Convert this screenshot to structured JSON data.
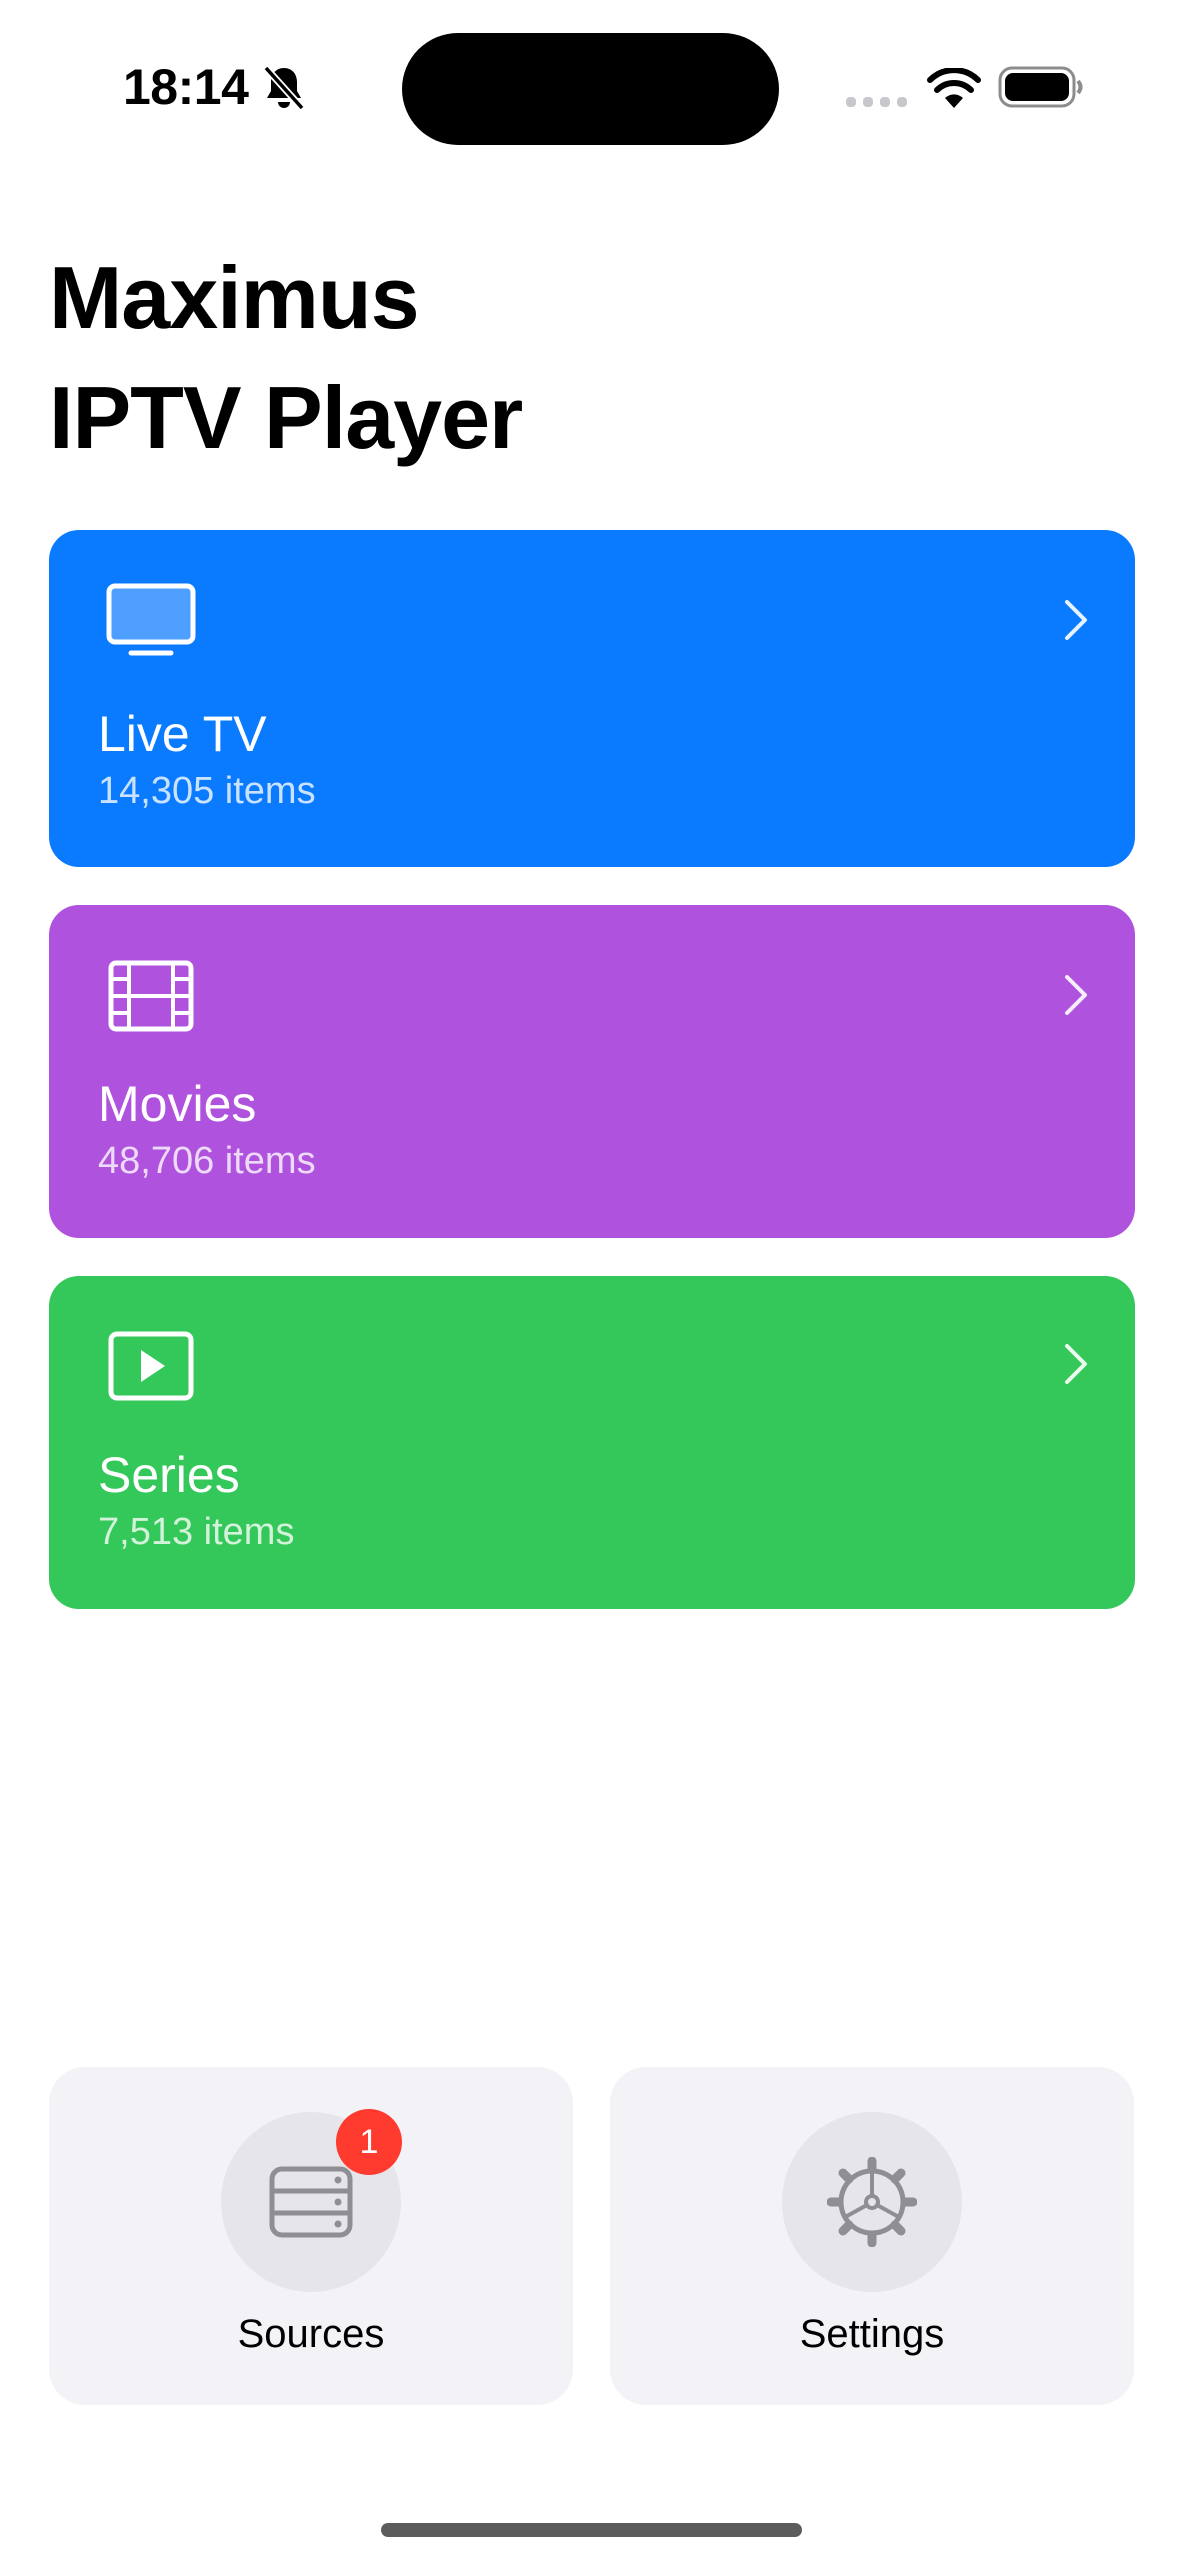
{
  "status_bar": {
    "time": "18:14",
    "icons": [
      "bell-slash-icon",
      "cellular-signal-icon",
      "wifi-icon",
      "battery-icon"
    ]
  },
  "title": "Maximus\nIPTV Player",
  "categories": [
    {
      "title": "Live TV",
      "subtitle": "14,305 items",
      "icon": "tv-icon",
      "color": "#0a7aff"
    },
    {
      "title": "Movies",
      "subtitle": "48,706 items",
      "icon": "film-icon",
      "color": "#af52de"
    },
    {
      "title": "Series",
      "subtitle": "7,513 items",
      "icon": "play-rectangle-icon",
      "color": "#34c759"
    }
  ],
  "tiles": [
    {
      "label": "Sources",
      "icon": "server-rack-icon",
      "badge": "1"
    },
    {
      "label": "Settings",
      "icon": "gear-icon"
    }
  ],
  "colors": {
    "badge": "#ff3b30",
    "tile_bg": "#f2f2f7"
  }
}
